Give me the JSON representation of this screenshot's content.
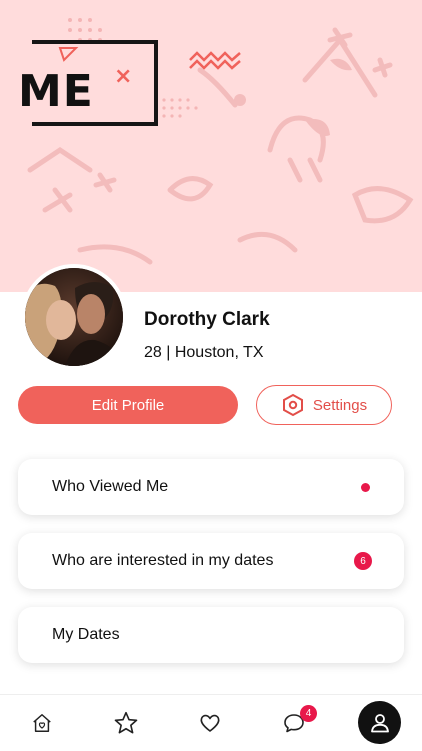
{
  "header": {
    "logo_text": "ME",
    "logo_mark": "×"
  },
  "profile": {
    "name": "Dorothy Clark",
    "meta": "28 | Houston, TX",
    "avatar": "couple-photo"
  },
  "actions": {
    "edit_label": "Edit Profile",
    "settings_label": "Settings",
    "settings_icon": "hexagon-settings-icon"
  },
  "menu": [
    {
      "label": "Who Viewed Me",
      "indicator": "dot"
    },
    {
      "label": "Who are interested in my dates",
      "badge": "6"
    },
    {
      "label": "My Dates"
    }
  ],
  "tabbar": {
    "items": [
      "home-icon",
      "star-icon",
      "heart-icon",
      "chat-icon",
      "profile-icon"
    ],
    "chat_badge": "4",
    "active": "profile"
  },
  "colors": {
    "accent": "#f0625b",
    "hero_bg": "#ffdcdc",
    "badge": "#e8184a"
  }
}
